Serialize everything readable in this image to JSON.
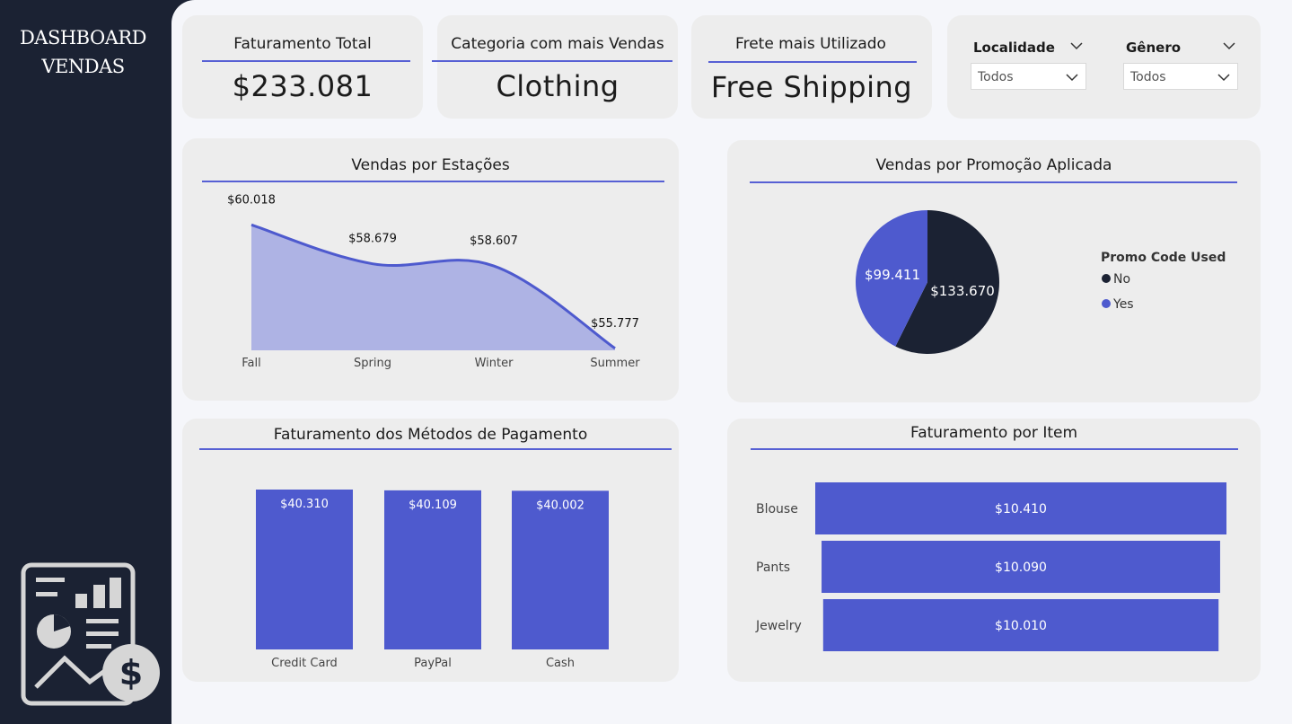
{
  "sidebar": {
    "title_line1": "DASHBOARD",
    "title_line2": "VENDAS",
    "logo_icon": "dashboard-report-dollar-icon"
  },
  "kpis": [
    {
      "title": "Faturamento Total",
      "value": "$233.081"
    },
    {
      "title": "Categoria com mais Vendas",
      "value": "Clothing"
    },
    {
      "title": "Frete mais Utilizado",
      "value": "Free Shipping"
    }
  ],
  "filters": {
    "localidade": {
      "label": "Localidade",
      "value": "Todos"
    },
    "genero": {
      "label": "Gênero",
      "value": "Todos"
    }
  },
  "colors": {
    "accent": "#4e5ace",
    "area_fill": "#aeb3e4",
    "dark": "#1b2233",
    "card": "#ededed"
  },
  "chart_data": [
    {
      "type": "area",
      "title": "Vendas por Estações",
      "categories": [
        "Fall",
        "Spring",
        "Winter",
        "Summer"
      ],
      "values": [
        60018,
        58679,
        58607,
        55777
      ],
      "labels": [
        "$60.018",
        "$58.679",
        "$58.607",
        "$55.777"
      ],
      "xlabel": "",
      "ylabel": "",
      "grid": false
    },
    {
      "type": "pie",
      "title": "Vendas por Promoção Aplicada",
      "legend_title": "Promo Code Used",
      "legend_position": "right",
      "slices": [
        {
          "name": "No",
          "value": 133670,
          "label": "$133.670",
          "color": "#1b2233"
        },
        {
          "name": "Yes",
          "value": 99411,
          "label": "$99.411",
          "color": "#4e5ace"
        }
      ]
    },
    {
      "type": "bar",
      "title": "Faturamento dos Métodos de Pagamento",
      "categories": [
        "Credit Card",
        "PayPal",
        "Cash"
      ],
      "values": [
        40310,
        40109,
        40002
      ],
      "labels": [
        "$40.310",
        "$40.109",
        "$40.002"
      ],
      "grid": false
    },
    {
      "type": "bar",
      "orientation": "horizontal",
      "title": "Faturamento por Item",
      "categories": [
        "Blouse",
        "Pants",
        "Jewelry"
      ],
      "values": [
        10410,
        10090,
        10010
      ],
      "labels": [
        "$10.410",
        "$10.090",
        "$10.010"
      ],
      "grid": false
    }
  ]
}
